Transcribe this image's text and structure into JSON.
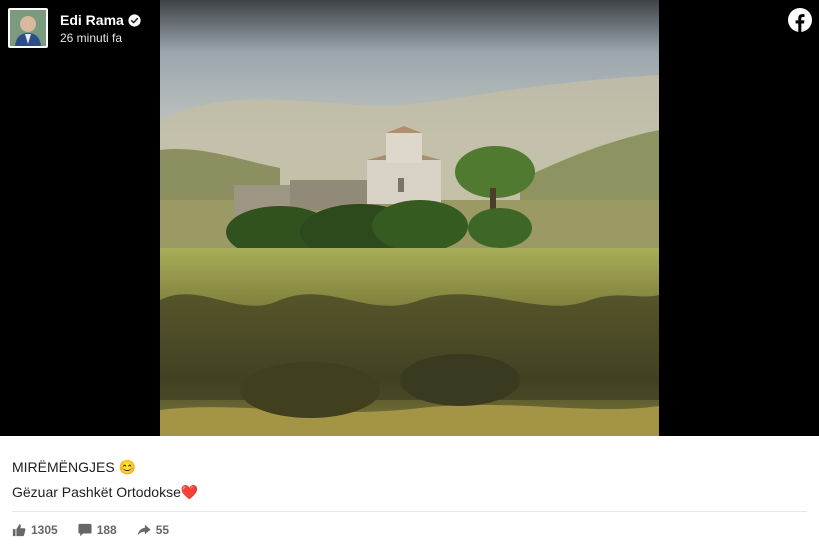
{
  "post": {
    "author": "Edi Rama",
    "time": "26 minuti fa",
    "caption_line1": "MIRËMËNGJES 😊",
    "caption_line2": "Gëzuar Pashkët Ortodokse❤️",
    "likes": "1305",
    "comments": "188",
    "shares": "55"
  },
  "icons": {
    "brand": "facebook-icon",
    "verified": "verified-badge-icon",
    "like": "thumbs-up-icon",
    "comment": "comment-bubble-icon",
    "share": "share-arrow-icon"
  },
  "colors": {
    "media_background": "#000000",
    "brand_badge": "#ffffff",
    "meta_text": "#65676b"
  }
}
